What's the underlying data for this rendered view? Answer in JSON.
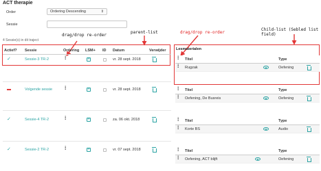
{
  "app": {
    "title": "ACT therapie"
  },
  "form": {
    "order_label": "Order",
    "order_value": "Ordering Descending",
    "sessie_label": "Sessie",
    "sessie_value": ""
  },
  "summary": "4 Sessie(s) in dit traject",
  "parent_table": {
    "headers": [
      "Actief?",
      "Sessie",
      "Ordering",
      "LSM+",
      "ID",
      "Datum",
      "Verwijder"
    ],
    "rows": [
      {
        "active": "check",
        "name": "Sessie-3 TR-2",
        "date": "vr. 28 sept. 2018"
      },
      {
        "active": "minus",
        "name": "Volgende sessie",
        "date": "vr. 28 sept. 2018"
      },
      {
        "active": "check",
        "name": "Sessie-4 TR-2",
        "date": "za. 06 okt. 2018"
      },
      {
        "active": "check",
        "name": "Sessie-2 TR-2",
        "date": "vr. 07 sept. 2018"
      }
    ]
  },
  "child_tables": {
    "top_header": "Lesmaterialen",
    "col_titel": "Titel",
    "col_type": "Type",
    "tables": [
      {
        "rows": [
          {
            "title": "Rugzak",
            "type": "Oefening"
          }
        ]
      },
      {
        "rows": [
          {
            "title": "Oefening, De Busreis",
            "type": "Oefening"
          }
        ]
      },
      {
        "rows": [
          {
            "title": "Korte BS",
            "type": "Audio"
          }
        ]
      },
      {
        "rows": [
          {
            "title": "Oefening, ACT blijft",
            "type": "Oefening"
          }
        ]
      }
    ]
  },
  "annotations": {
    "drag_drop_left": "drag/drop re-order",
    "parent_list": "parent-list",
    "drag_drop_right": "drag/drop re-order",
    "child_list": "Child-list (Sebled list field)"
  },
  "icons": {
    "drag": "drag-handle-icon",
    "lsm": "plus-square-icon",
    "id": "checkbox-icon",
    "delete": "trash-icon",
    "view": "eye-icon",
    "active": "checkmark-icon",
    "inactive": "minus-icon"
  },
  "colors": {
    "accent": "#2aa3a3",
    "annotation": "#e23636"
  }
}
